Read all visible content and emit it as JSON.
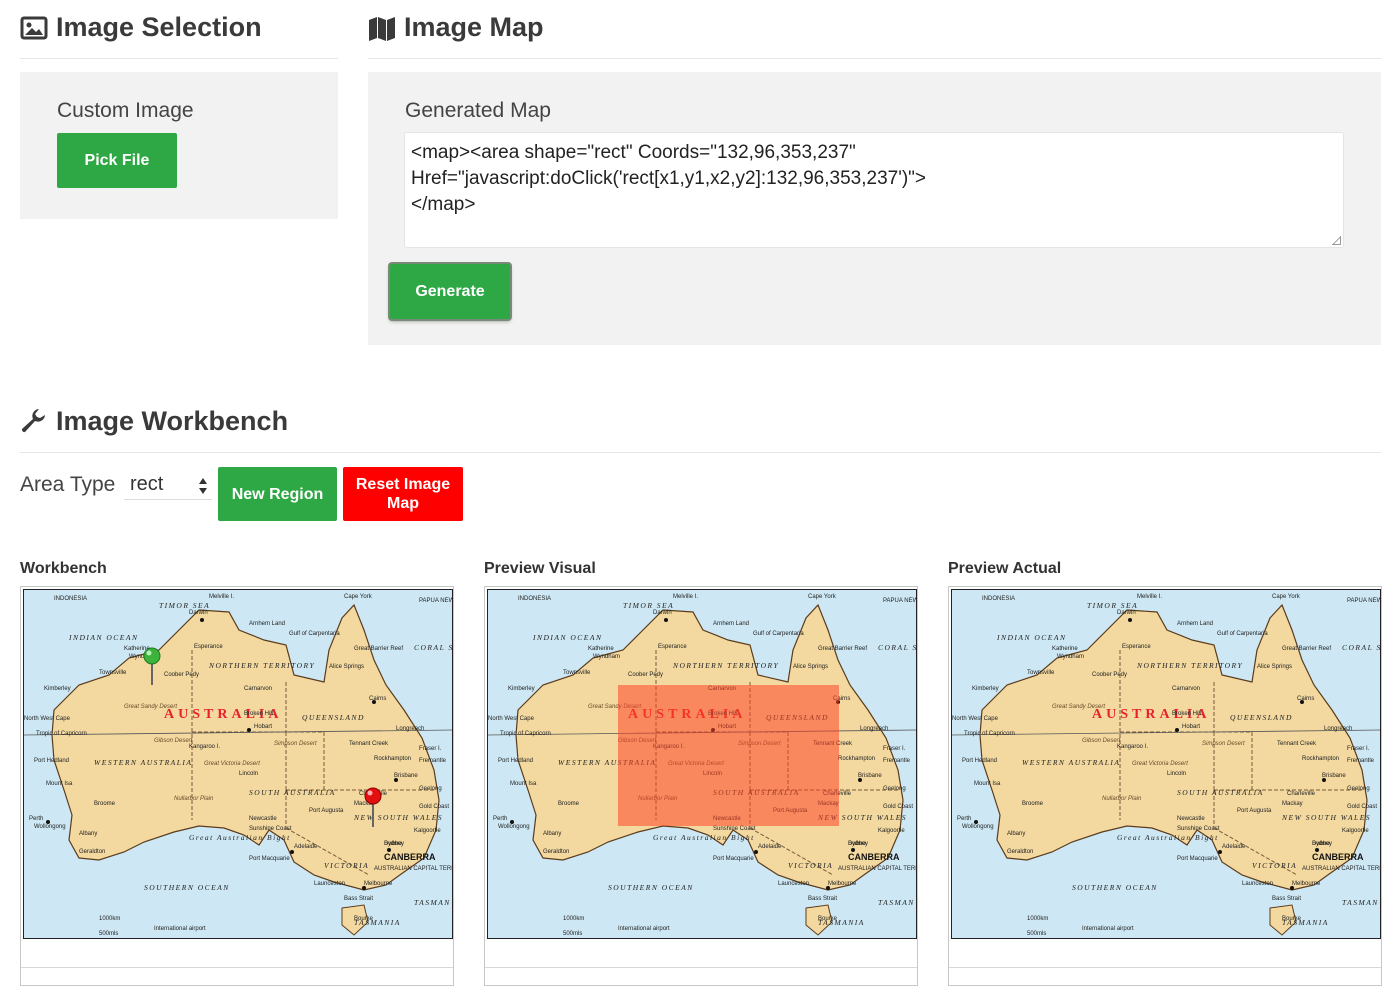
{
  "sections": {
    "selection_title": "Image Selection",
    "map_title": "Image Map",
    "workbench_title": "Image Workbench"
  },
  "selection": {
    "custom_label": "Custom Image",
    "pick_button": "Pick File"
  },
  "image_map": {
    "generated_label": "Generated Map",
    "code": "<map><area shape=\"rect\" Coords=\"132,96,353,237\"\nHref=\"javascript:doClick('rect[x1,y1,x2,y2]:132,96,353,237')\">\n</map>",
    "generate_button": "Generate"
  },
  "workbench_controls": {
    "area_type_label": "Area Type",
    "area_type_value": "rect",
    "new_region_button": "New Region",
    "reset_button": "Reset Image Map"
  },
  "panels": [
    {
      "caption": "Workbench"
    },
    {
      "caption": "Preview Visual"
    },
    {
      "caption": "Preview Actual"
    }
  ],
  "map_labels": {
    "country": "AUSTRALIA",
    "states": [
      "WESTERN AUSTRALIA",
      "NORTHERN TERRITORY",
      "QUEENSLAND",
      "SOUTH AUSTRALIA",
      "NEW SOUTH WALES",
      "VICTORIA",
      "TASMANIA"
    ],
    "seas": [
      "INDIAN OCEAN",
      "TIMOR SEA",
      "CORAL SEA",
      "SOUTHERN OCEAN",
      "TASMAN SEA",
      "Great Australian Bight"
    ],
    "deserts": [
      "Great Sandy Desert",
      "Gibson Desert",
      "Great Victoria Desert",
      "Simpson Desert",
      "Nullarbor Plain"
    ],
    "cities": [
      "Perth",
      "Darwin",
      "Brisbane",
      "Sydney",
      "Melbourne",
      "Adelaide",
      "Hobart",
      "Alice Springs",
      "Cairns",
      "Townsville",
      "Broome",
      "Kalgoorlie",
      "Newcastle",
      "Port Augusta",
      "Broken Hill",
      "Mount Isa",
      "Geraldton",
      "Albany",
      "Esperance",
      "Katherine",
      "Wyndham",
      "Kimberley",
      "Port Hedland",
      "Carnarvon",
      "Tennant Creek",
      "Longreach",
      "Rockhampton",
      "Mackay",
      "Charleville",
      "Bourke",
      "Dubbo",
      "Launceston",
      "Wollongong",
      "Geelong",
      "Fremantle",
      "Gold Coast",
      "Sunshine Coast",
      "Port Macquarie",
      "Lincoln",
      "Kangaroo I.",
      "Coober Pedy",
      "Uluru (Ayers Rock)",
      "Halls Creek"
    ],
    "capital": "CANBERRA",
    "other": [
      "INDONESIA",
      "PAPUA NEW GUINEA",
      "Cape York",
      "Melville I.",
      "Arnhem Land",
      "Gulf of Carpentaria",
      "Great Barrier Reef",
      "Tropic of Capricorn",
      "North West Cape",
      "Bass Strait",
      "Fraser I.",
      "AUSTRALIAN CAPITAL TERRITORY",
      "International airport",
      "1000km",
      "500mls"
    ]
  },
  "colors": {
    "button_green": "#2ea844",
    "button_red": "#ff0000",
    "panel_bg": "#f1f2f1",
    "land": "#f3d9a0",
    "ocean": "#cde8f4",
    "overlay": "rgba(255,70,40,0.55)"
  },
  "icons": {
    "selection": "image-icon",
    "map": "map-icon",
    "workbench": "wrench-icon",
    "pin_green": "map-pin-green-icon",
    "pin_red": "map-pin-red-icon"
  }
}
